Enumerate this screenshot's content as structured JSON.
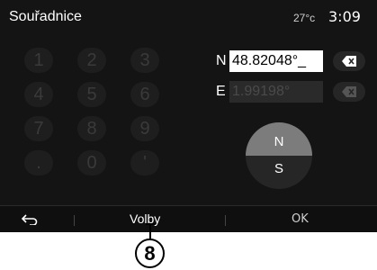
{
  "header": {
    "title": "Souřadnice",
    "temperature": "27°c",
    "time": "3:09"
  },
  "keypad": {
    "keys": [
      "1",
      "2",
      "3",
      "4",
      "5",
      "6",
      "7",
      "8",
      "9",
      ".",
      "0",
      "'"
    ]
  },
  "coordinates": {
    "n_label": "N",
    "n_value": "48.82048°_",
    "e_label": "E",
    "e_value": "1.99198°"
  },
  "dial": {
    "north": "N",
    "south": "S"
  },
  "bottom_bar": {
    "options_label": "Volby",
    "ok_label": "OK"
  },
  "callout": {
    "number": "8"
  },
  "colors": {
    "background": "#141414",
    "field_active": "#ffffff",
    "dial_selected": "#7c7c7c"
  }
}
